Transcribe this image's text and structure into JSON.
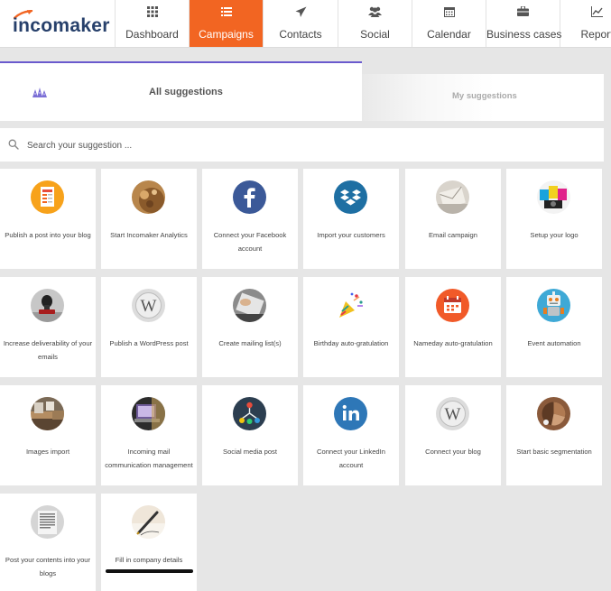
{
  "app": {
    "logo_text": "incomaker"
  },
  "nav": {
    "items": [
      {
        "label": "Dashboard",
        "icon": "dashboard-icon"
      },
      {
        "label": "Campaigns",
        "icon": "list-icon",
        "active": true
      },
      {
        "label": "Contacts",
        "icon": "paper-plane-icon"
      },
      {
        "label": "Social",
        "icon": "users-icon"
      },
      {
        "label": "Calendar",
        "icon": "calendar-icon"
      },
      {
        "label": "Business cases",
        "icon": "briefcase-icon"
      },
      {
        "label": "Report",
        "icon": "line-chart-icon"
      }
    ],
    "accent_color": "#f26522"
  },
  "tabs": {
    "all_label": "All suggestions",
    "my_label": "My suggestions",
    "active_color": "#6a5acd"
  },
  "search": {
    "placeholder": "Search your suggestion ..."
  },
  "suggestions": [
    {
      "label": "Publish a post into your blog",
      "icon": "blog-post-icon"
    },
    {
      "label": "Start Incomaker Analytics",
      "icon": "analytics-icon"
    },
    {
      "label": "Connect your Facebook account",
      "icon": "facebook-icon"
    },
    {
      "label": "Import your customers",
      "icon": "dropbox-icon"
    },
    {
      "label": "Email campaign",
      "icon": "email-icon"
    },
    {
      "label": "Setup your logo",
      "icon": "logo-icon"
    },
    {
      "label": "Increase deliverability of your emails",
      "icon": "stamp-icon"
    },
    {
      "label": "Publish a WordPress post",
      "icon": "wordpress-icon"
    },
    {
      "label": "Create mailing list(s)",
      "icon": "mailing-list-icon"
    },
    {
      "label": "Birthday auto-gratulation",
      "icon": "party-popper-icon"
    },
    {
      "label": "Nameday auto-gratulation",
      "icon": "calendar-icon"
    },
    {
      "label": "Event automation",
      "icon": "robot-icon"
    },
    {
      "label": "Images import",
      "icon": "images-icon"
    },
    {
      "label": "Incoming mail communication management",
      "icon": "mail-management-icon"
    },
    {
      "label": "Social media post",
      "icon": "social-network-icon"
    },
    {
      "label": "Connect your LinkedIn account",
      "icon": "linkedin-icon"
    },
    {
      "label": "Connect your blog",
      "icon": "wordpress-icon"
    },
    {
      "label": "Start basic segmentation",
      "icon": "segmentation-icon"
    },
    {
      "label": "Post your contents into your blogs",
      "icon": "document-icon"
    },
    {
      "label": "Fill in company details",
      "icon": "pen-icon"
    }
  ]
}
